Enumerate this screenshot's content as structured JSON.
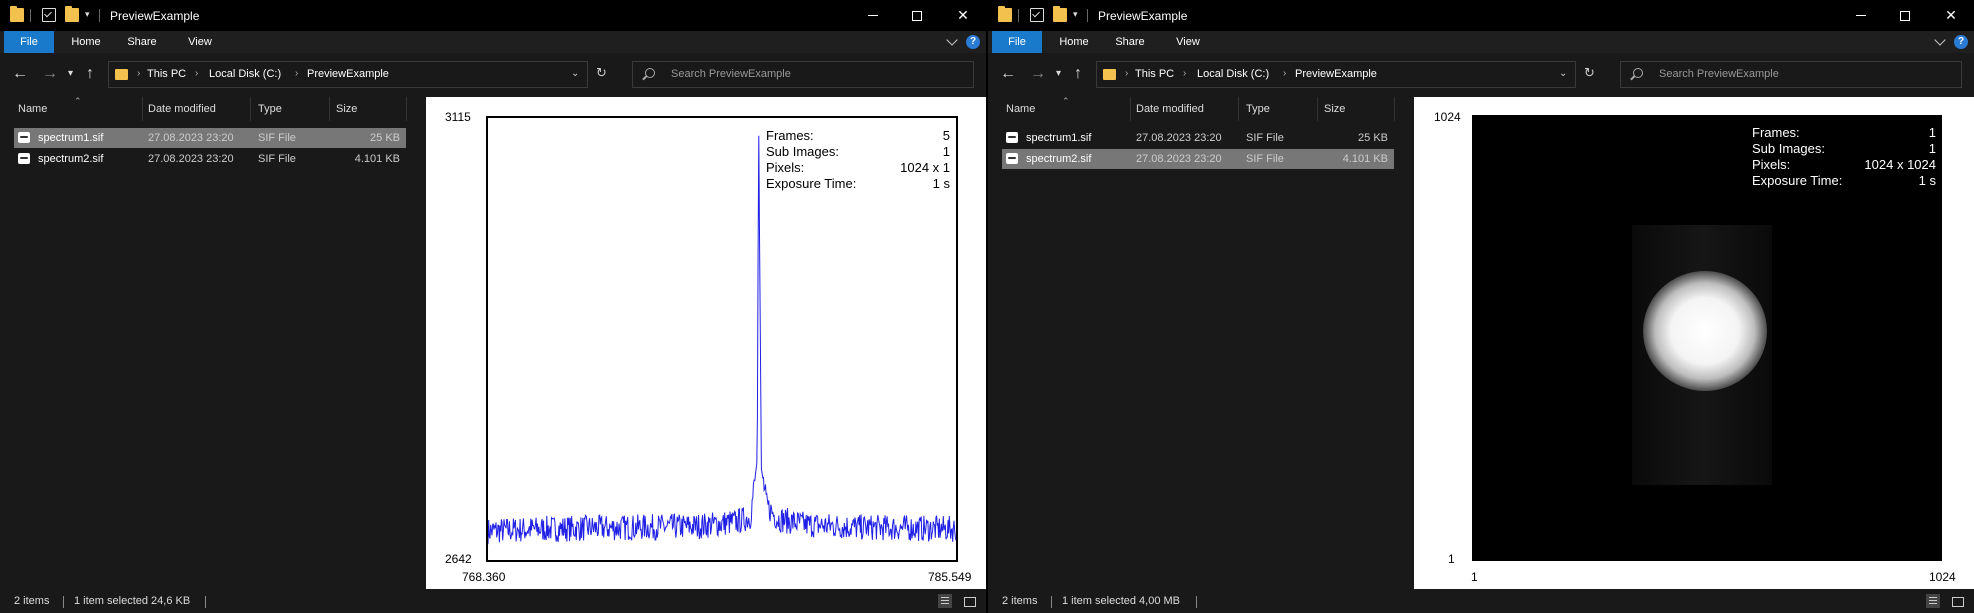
{
  "windows": [
    {
      "title": "PreviewExample",
      "ribbon_tabs": [
        "File",
        "Home",
        "Share",
        "View"
      ],
      "breadcrumb": [
        "This PC",
        "Local Disk (C:)",
        "PreviewExample"
      ],
      "search_placeholder": "Search PreviewExample",
      "columns": [
        "Name",
        "Date modified",
        "Type",
        "Size"
      ],
      "files": [
        {
          "name": "spectrum1.sif",
          "date": "27.08.2023 23:20",
          "type": "SIF File",
          "size": "25 KB",
          "selected": true
        },
        {
          "name": "spectrum2.sif",
          "date": "27.08.2023 23:20",
          "type": "SIF File",
          "size": "4.101 KB",
          "selected": false
        }
      ],
      "status": {
        "items": "2 items",
        "selection": "1 item selected  24,6 KB"
      },
      "preview": {
        "y_max": "3115",
        "y_min": "2642",
        "x_min": "768.360",
        "x_max": "785.549",
        "info": [
          {
            "k": "Frames:",
            "v": "5"
          },
          {
            "k": "Sub Images:",
            "v": "1"
          },
          {
            "k": "Pixels:",
            "v": "1024 x 1"
          },
          {
            "k": "Exposure Time:",
            "v": "1 s"
          }
        ]
      }
    },
    {
      "title": "PreviewExample",
      "ribbon_tabs": [
        "File",
        "Home",
        "Share",
        "View"
      ],
      "breadcrumb": [
        "This PC",
        "Local Disk (C:)",
        "PreviewExample"
      ],
      "search_placeholder": "Search PreviewExample",
      "columns": [
        "Name",
        "Date modified",
        "Type",
        "Size"
      ],
      "files": [
        {
          "name": "spectrum1.sif",
          "date": "27.08.2023 23:20",
          "type": "SIF File",
          "size": "25 KB",
          "selected": false
        },
        {
          "name": "spectrum2.sif",
          "date": "27.08.2023 23:20",
          "type": "SIF File",
          "size": "4.101 KB",
          "selected": true
        }
      ],
      "status": {
        "items": "2 items",
        "selection": "1 item selected  4,00 MB"
      },
      "preview": {
        "y_max": "1024",
        "y_min": "1",
        "x_min": "1",
        "x_max": "1024",
        "info": [
          {
            "k": "Frames:",
            "v": "1"
          },
          {
            "k": "Sub Images:",
            "v": "1"
          },
          {
            "k": "Pixels:",
            "v": "1024 x 1024"
          },
          {
            "k": "Exposure Time:",
            "v": "1 s"
          }
        ]
      }
    }
  ],
  "chart_data": {
    "type": "line",
    "x_range": [
      768.36,
      785.549
    ],
    "ylim": [
      2642,
      3115
    ],
    "series": [
      {
        "color": "#1f1fe6",
        "x": [
          768.36,
          770.0,
          772.0,
          774.0,
          776.0,
          777.5,
          778.0,
          778.25,
          778.3,
          778.4,
          778.6,
          779.0,
          780.0,
          782.0,
          784.0,
          785.549
        ],
        "values": [
          2673,
          2675,
          2676,
          2677,
          2678,
          2683,
          2688,
          2750,
          3115,
          2740,
          2700,
          2686,
          2680,
          2677,
          2676,
          2675
        ]
      }
    ],
    "colors": {
      "line": "#1f1fe6"
    }
  }
}
